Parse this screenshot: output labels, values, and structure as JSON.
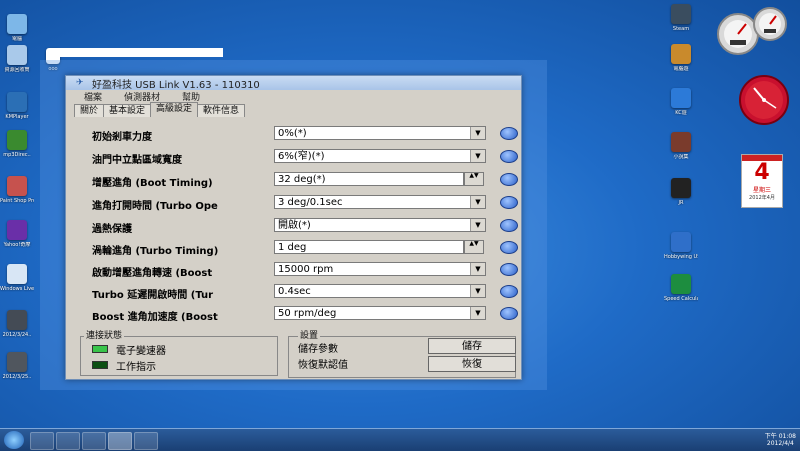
{
  "desktop": {
    "left_icons": [
      {
        "label": "電腦",
        "color": "#7db7e8"
      },
      {
        "label": "資源回收筒",
        "color": "#a9c9ea"
      },
      {
        "label": "KMPlayer",
        "color": "#2b6fb5"
      },
      {
        "label": "mp3Direc..",
        "color": "#3a8a2f"
      },
      {
        "label": "Paint Shop Pro",
        "color": "#c6524e"
      },
      {
        "label": "Yahoo!奇摩",
        "color": "#6a2fa8"
      },
      {
        "label": "Windows Live",
        "color": "#d8e6f5"
      },
      {
        "label": "2012/3/24..",
        "color": "#444b55"
      },
      {
        "label": "2012/3/25..",
        "color": "#50565e"
      }
    ],
    "top_file_label": "ooo",
    "right_icons": [
      {
        "label": "Steam",
        "color": "#3a4d5f"
      },
      {
        "label": "電腦遊",
        "color": "#c98a2c"
      },
      {
        "label": "KC遊",
        "color": "#2c7ad8"
      },
      {
        "label": "小說集",
        "color": "#7a3b2c"
      },
      {
        "label": "JR",
        "color": "#222"
      },
      {
        "label": "Hobbywing USB Link",
        "color": "#2f6fc9"
      },
      {
        "label": "Speed Calculator",
        "color": "#1d8d3f"
      }
    ],
    "calendar": {
      "day": "4",
      "weekday": "星期三",
      "month_line": "2012年4月"
    }
  },
  "window": {
    "title": "好盈科技 USB Link V1.63 - 110310",
    "menu": [
      "檔案",
      "偵測器材",
      "幫助"
    ],
    "tabs": [
      "關於",
      "基本設定",
      "高級設定",
      "軟件信息"
    ],
    "active_tab": 2,
    "rows": [
      {
        "label": "初始剎車力度",
        "value": "0%(*)",
        "kind": "dropdown"
      },
      {
        "label": "油門中立點區域寬度",
        "value": "6%(窄)(*)",
        "kind": "dropdown"
      },
      {
        "label": "增壓進角 (Boot Timing)",
        "value": "32 deg(*)",
        "kind": "spin"
      },
      {
        "label": "進角打開時間 (Turbo Ope",
        "value": "3 deg/0.1sec",
        "kind": "dropdown"
      },
      {
        "label": "過熱保護",
        "value": "開啟(*)",
        "kind": "dropdown"
      },
      {
        "label": "渦輪進角 (Turbo Timing)",
        "value": "1 deg",
        "kind": "spin"
      },
      {
        "label": "啟動增壓進角轉速 (Boost",
        "value": "15000 rpm",
        "kind": "dropdown"
      },
      {
        "label": "Turbo 延遲開啟時間 (Tur",
        "value": "0.4sec",
        "kind": "dropdown"
      },
      {
        "label": "Boost 進角加速度 (Boost",
        "value": "50 rpm/deg",
        "kind": "dropdown"
      }
    ],
    "status": {
      "header": "連接狀態",
      "items": [
        {
          "label": "電子變速器",
          "led": "#39c44a"
        },
        {
          "label": "工作指示",
          "led": "#0c4f12"
        }
      ]
    },
    "settings": {
      "header": "設置",
      "save_text": "儲存參數",
      "restore_text": "恢復默認值",
      "save_button": "儲存",
      "restore_button": "恢復"
    }
  },
  "tray": {
    "time": "下午 01:08",
    "date": "2012/4/4"
  }
}
